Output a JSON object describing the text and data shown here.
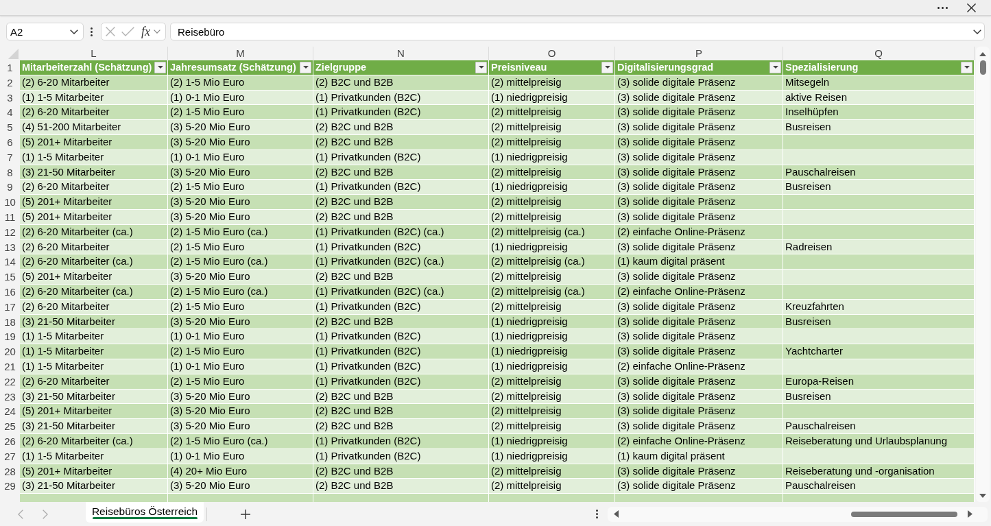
{
  "name_box": {
    "value": "A2"
  },
  "formula_bar": {
    "function_label": "fx",
    "value": "Reisebüro"
  },
  "sheet": {
    "column_letters": [
      "L",
      "M",
      "N",
      "O",
      "P",
      "Q"
    ],
    "header_row": {
      "number": "1",
      "cells": [
        "Mitarbeiterzahl (Schätzung)",
        "Jahresumsatz (Schätzung)",
        "Zielgruppe",
        "Preisniveau",
        "Digitalisierungsgrad",
        "Spezialisierung"
      ]
    },
    "rows": [
      {
        "number": "2",
        "cells": [
          "(2) 6-20 Mitarbeiter",
          "(2) 1-5 Mio Euro",
          "(2) B2C und B2B",
          "(2) mittelpreisig",
          "(3) solide digitale Präsenz",
          "Mitsegeln"
        ]
      },
      {
        "number": "3",
        "cells": [
          "(1) 1-5 Mitarbeiter",
          "(1) 0-1 Mio Euro",
          "(1) Privatkunden (B2C)",
          "(1) niedrigpreisig",
          "(3) solide digitale Präsenz",
          "aktive Reisen"
        ]
      },
      {
        "number": "4",
        "cells": [
          "(2) 6-20 Mitarbeiter",
          "(2) 1-5 Mio Euro",
          "(1) Privatkunden (B2C)",
          "(2) mittelpreisig",
          "(3) solide digitale Präsenz",
          "Inselhüpfen"
        ]
      },
      {
        "number": "5",
        "cells": [
          "(4) 51-200 Mitarbeiter",
          "(3) 5-20 Mio Euro",
          "(2) B2C und B2B",
          "(2) mittelpreisig",
          "(3) solide digitale Präsenz",
          "Busreisen"
        ]
      },
      {
        "number": "6",
        "cells": [
          "(5) 201+ Mitarbeiter",
          "(3) 5-20 Mio Euro",
          "(2) B2C und B2B",
          "(2) mittelpreisig",
          "(3) solide digitale Präsenz"
        ]
      },
      {
        "number": "7",
        "cells": [
          "(1) 1-5 Mitarbeiter",
          "(1) 0-1 Mio Euro",
          "(1) Privatkunden (B2C)",
          "(1) niedrigpreisig",
          "(3) solide digitale Präsenz"
        ]
      },
      {
        "number": "8",
        "cells": [
          "(3) 21-50 Mitarbeiter",
          "(3) 5-20 Mio Euro",
          "(2) B2C und B2B",
          "(2) mittelpreisig",
          "(3) solide digitale Präsenz",
          "Pauschalreisen"
        ]
      },
      {
        "number": "9",
        "cells": [
          "(2) 6-20 Mitarbeiter",
          "(2) 1-5 Mio Euro",
          "(1) Privatkunden (B2C)",
          "(1) niedrigpreisig",
          "(3) solide digitale Präsenz",
          "Busreisen"
        ]
      },
      {
        "number": "10",
        "cells": [
          "(5) 201+ Mitarbeiter",
          "(3) 5-20 Mio Euro",
          "(2) B2C und B2B",
          "(2) mittelpreisig",
          "(3) solide digitale Präsenz"
        ]
      },
      {
        "number": "11",
        "cells": [
          "(5) 201+ Mitarbeiter",
          "(3) 5-20 Mio Euro",
          "(2) B2C und B2B",
          "(2) mittelpreisig",
          "(3) solide digitale Präsenz"
        ]
      },
      {
        "number": "12",
        "cells": [
          "(2) 6-20 Mitarbeiter (ca.)",
          "(2) 1-5 Mio Euro (ca.)",
          "(1) Privatkunden (B2C) (ca.)",
          "(2) mittelpreisig (ca.)",
          "(2) einfache Online-Präsenz"
        ]
      },
      {
        "number": "13",
        "cells": [
          "(2) 6-20 Mitarbeiter",
          "(2) 1-5 Mio Euro",
          "(1) Privatkunden (B2C)",
          "(1) niedrigpreisig",
          "(3) solide digitale Präsenz",
          "Radreisen"
        ]
      },
      {
        "number": "14",
        "cells": [
          "(2) 6-20 Mitarbeiter (ca.)",
          "(2) 1-5 Mio Euro (ca.)",
          "(1) Privatkunden (B2C) (ca.)",
          "(2) mittelpreisig (ca.)",
          "(1) kaum digital präsent"
        ]
      },
      {
        "number": "15",
        "cells": [
          "(5) 201+ Mitarbeiter",
          "(3) 5-20 Mio Euro",
          "(2) B2C und B2B",
          "(2) mittelpreisig",
          "(3) solide digitale Präsenz"
        ]
      },
      {
        "number": "16",
        "cells": [
          "(2) 6-20 Mitarbeiter (ca.)",
          "(2) 1-5 Mio Euro (ca.)",
          "(1) Privatkunden (B2C) (ca.)",
          "(2) mittelpreisig (ca.)",
          "(2) einfache Online-Präsenz"
        ]
      },
      {
        "number": "17",
        "cells": [
          "(2) 6-20 Mitarbeiter",
          "(2) 1-5 Mio Euro",
          "(1) Privatkunden (B2C)",
          "(2) mittelpreisig",
          "(3) solide digitale Präsenz",
          "Kreuzfahrten"
        ]
      },
      {
        "number": "18",
        "cells": [
          "(3) 21-50 Mitarbeiter",
          "(3) 5-20 Mio Euro",
          "(2) B2C und B2B",
          "(1) niedrigpreisig",
          "(3) solide digitale Präsenz",
          "Busreisen"
        ]
      },
      {
        "number": "19",
        "cells": [
          "(1) 1-5 Mitarbeiter",
          "(1) 0-1 Mio Euro",
          "(1) Privatkunden (B2C)",
          "(1) niedrigpreisig",
          "(3) solide digitale Präsenz"
        ]
      },
      {
        "number": "20",
        "cells": [
          "(1) 1-5 Mitarbeiter",
          "(2) 1-5 Mio Euro",
          "(1) Privatkunden (B2C)",
          "(1) niedrigpreisig",
          "(3) solide digitale Präsenz",
          "Yachtcharter"
        ]
      },
      {
        "number": "21",
        "cells": [
          "(1) 1-5 Mitarbeiter",
          "(1) 0-1 Mio Euro",
          "(1) Privatkunden (B2C)",
          "(1) niedrigpreisig",
          "(2) einfache Online-Präsenz"
        ]
      },
      {
        "number": "22",
        "cells": [
          "(2) 6-20 Mitarbeiter",
          "(2) 1-5 Mio Euro",
          "(1) Privatkunden (B2C)",
          "(2) mittelpreisig",
          "(3) solide digitale Präsenz",
          "Europa-Reisen"
        ]
      },
      {
        "number": "23",
        "cells": [
          "(3) 21-50 Mitarbeiter",
          "(3) 5-20 Mio Euro",
          "(2) B2C und B2B",
          "(2) mittelpreisig",
          "(3) solide digitale Präsenz",
          "Busreisen"
        ]
      },
      {
        "number": "24",
        "cells": [
          "(5) 201+ Mitarbeiter",
          "(3) 5-20 Mio Euro",
          "(2) B2C und B2B",
          "(2) mittelpreisig",
          "(3) solide digitale Präsenz"
        ]
      },
      {
        "number": "25",
        "cells": [
          "(3) 21-50 Mitarbeiter",
          "(3) 5-20 Mio Euro",
          "(2) B2C und B2B",
          "(2) mittelpreisig",
          "(3) solide digitale Präsenz",
          "Pauschalreisen"
        ]
      },
      {
        "number": "26",
        "cells": [
          "(2) 6-20 Mitarbeiter (ca.)",
          "(2) 1-5 Mio Euro (ca.)",
          "(1) Privatkunden (B2C)",
          "(1) niedrigpreisig",
          "(2) einfache Online-Präsenz",
          "Reiseberatung und Urlaubsplanung"
        ]
      },
      {
        "number": "27",
        "cells": [
          "(1) 1-5 Mitarbeiter",
          "(1) 0-1 Mio Euro",
          "(1) Privatkunden (B2C)",
          "(1) niedrigpreisig",
          "(1) kaum digital präsent"
        ]
      },
      {
        "number": "28",
        "cells": [
          "(5) 201+ Mitarbeiter",
          "(4) 20+ Mio Euro",
          "(2) B2C und B2B",
          "(2) mittelpreisig",
          "(3) solide digitale Präsenz",
          "Reiseberatung und -organisation"
        ]
      },
      {
        "number": "29",
        "cells": [
          "(3) 21-50 Mitarbeiter",
          "(3) 5-20 Mio Euro",
          "(2) B2C und B2B",
          "(2) mittelpreisig",
          "(3) solide digitale Präsenz",
          "Pauschalreisen"
        ]
      }
    ]
  },
  "sheet_tabs": [
    {
      "label": "Reisebüros Österreich",
      "selected": true
    }
  ]
}
